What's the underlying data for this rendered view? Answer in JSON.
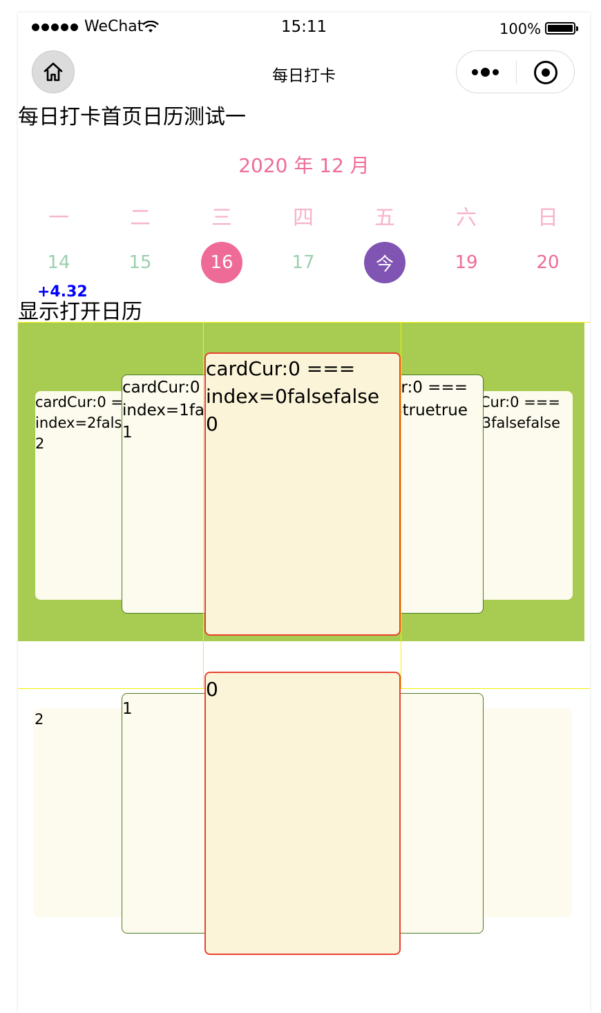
{
  "status_bar": {
    "carrier": "WeChat",
    "time": "15:11",
    "battery_percent": "100%"
  },
  "nav": {
    "title": "每日打卡",
    "home_icon": "home-icon",
    "menu_icon": "more-dots-icon",
    "close_icon": "target-circle-icon"
  },
  "page": {
    "heading": "每日打卡首页日历测试一",
    "open_calendar": "显示打开日历",
    "score": "+4.32"
  },
  "calendar": {
    "month_label": "2020 年 12 月",
    "weekdays": [
      "一",
      "二",
      "三",
      "四",
      "五",
      "六",
      "日"
    ],
    "days": [
      "14",
      "15",
      "16",
      "17",
      "今",
      "19",
      "20"
    ],
    "colors": {
      "accent_pink": "#ee6b98",
      "weekday_pink": "#f6b3c9",
      "weekday_day_green": "#9ccfae",
      "today_purple": "#8054b3"
    }
  },
  "swiper_top": {
    "band_color": "#a8cc52",
    "cards": [
      {
        "line1": "cardCur:0 ===",
        "line2": "index=2falsefalse",
        "line3": "2"
      },
      {
        "line1": "cardCur:0 ===",
        "line2": "index=1falsefalse",
        "line3": "1"
      },
      {
        "line1": "cardCur:0 ===",
        "line2": "index=0falsefalse",
        "line3": "0"
      },
      {
        "line1": "cardCur:0 ===",
        "line2": "index=4truetrue",
        "line3": ""
      },
      {
        "line1": "cardCur:0 ===",
        "line2": "index=3falsefalse",
        "line3": ""
      }
    ]
  },
  "swiper_bottom": {
    "cards": [
      {
        "label": "2"
      },
      {
        "label": "1"
      },
      {
        "label": "0"
      }
    ]
  }
}
